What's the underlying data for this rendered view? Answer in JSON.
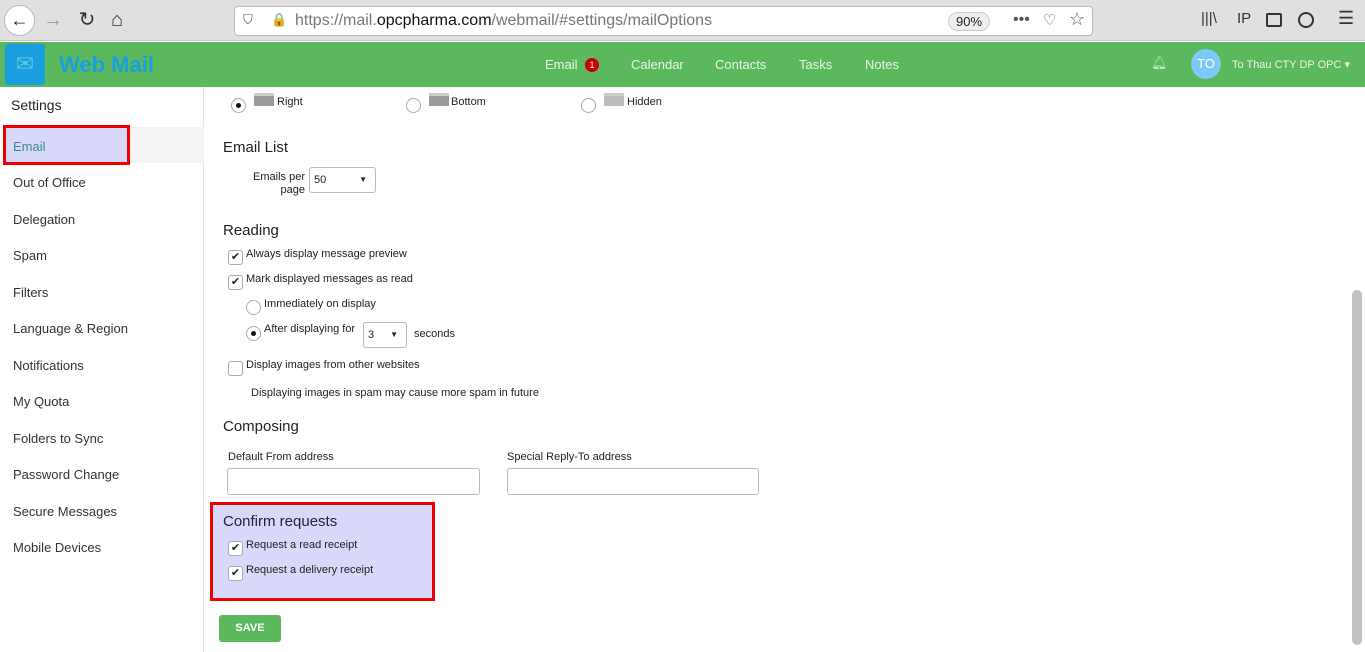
{
  "browser": {
    "url_prefix": "https://mail.",
    "url_domain": "opcpharma.com",
    "url_path": "/webmail/#settings/mailOptions",
    "zoom": "90%"
  },
  "app": {
    "brand": "Web Mail",
    "nav": [
      {
        "label": "Email",
        "badge": "1"
      },
      {
        "label": "Calendar"
      },
      {
        "label": "Contacts"
      },
      {
        "label": "Tasks"
      },
      {
        "label": "Notes"
      }
    ],
    "user_initials": "TO",
    "user_name": "To Thau CTY DP OPC",
    "accent": "#5cb85c"
  },
  "sidebar": {
    "title": "Settings",
    "items": [
      "Email",
      "Out of Office",
      "Delegation",
      "Spam",
      "Filters",
      "Language & Region",
      "Notifications",
      "My Quota",
      "Folders to Sync",
      "Password Change",
      "Secure Messages",
      "Mobile Devices"
    ],
    "selected": "Email"
  },
  "preview": {
    "options": [
      "Right",
      "Bottom",
      "Hidden"
    ],
    "selected": "Right"
  },
  "email_list": {
    "title": "Email List",
    "per_page_label_1": "Emails per",
    "per_page_label_2": "page",
    "per_page_value": "50"
  },
  "reading": {
    "title": "Reading",
    "always_preview": "Always display message preview",
    "mark_read": "Mark displayed messages as read",
    "immediately": "Immediately on display",
    "after": "After displaying for",
    "after_value": "3",
    "seconds": "seconds",
    "display_images": "Display images from other websites",
    "images_note": "Displaying images in spam may cause more spam in future"
  },
  "composing": {
    "title": "Composing",
    "from_label": "Default From address",
    "from_value": "",
    "reply_label": "Special Reply-To address",
    "reply_value": ""
  },
  "confirm": {
    "title": "Confirm requests",
    "read_receipt": "Request a read receipt",
    "delivery_receipt": "Request a delivery receipt"
  },
  "save_label": "SAVE"
}
